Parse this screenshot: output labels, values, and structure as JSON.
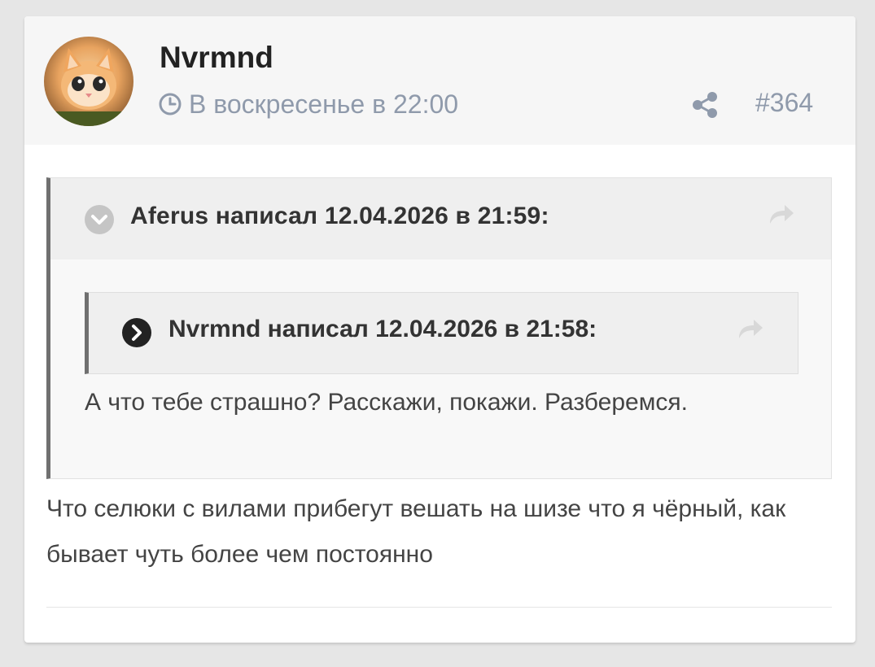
{
  "post": {
    "author": "Nvrmnd",
    "timestamp": "В воскресенье в 22:00",
    "number": "#364"
  },
  "quote": {
    "header": "Aferus написал 12.04.2026 в 21:59:",
    "nested": {
      "header": "Nvrmnd написал 12.04.2026 в 21:58:"
    },
    "text": "А что тебе страшно? Расскажи, покажи. Разберемся."
  },
  "reply_text": "Что селюки с вилами прибегут вешать на шизе что я чёрный, как бывает чуть более чем постоянно",
  "colors": {
    "meta": "#8f9aab",
    "quote_bar": "#707070",
    "header_bg": "#f6f6f6"
  }
}
